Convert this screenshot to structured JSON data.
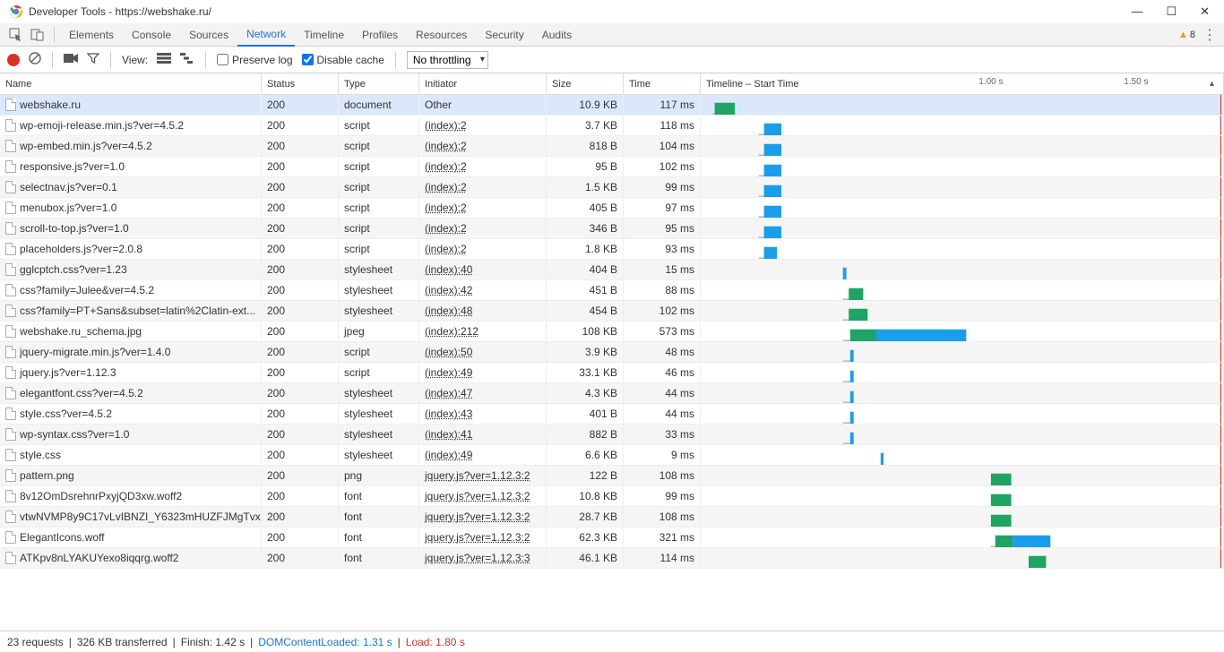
{
  "window": {
    "title": "Developer Tools - https://webshake.ru/"
  },
  "tabs": [
    "Elements",
    "Console",
    "Sources",
    "Network",
    "Timeline",
    "Profiles",
    "Resources",
    "Security",
    "Audits"
  ],
  "active_tab": "Network",
  "warnings_count": "8",
  "toolbar": {
    "view_label": "View:",
    "preserve_log": "Preserve log",
    "preserve_log_checked": false,
    "disable_cache": "Disable cache",
    "disable_cache_checked": true,
    "throttling": "No throttling"
  },
  "columns": {
    "name": "Name",
    "status": "Status",
    "type": "Type",
    "initiator": "Initiator",
    "size": "Size",
    "time": "Time",
    "timeline": "Timeline – Start Time"
  },
  "timeline": {
    "total_ms": 1800,
    "ticks": [
      {
        "ms": 1000,
        "label": "1.00 s"
      },
      {
        "ms": 1500,
        "label": "1.50 s"
      }
    ],
    "red_line_ms": 1790
  },
  "requests": [
    {
      "name": "webshake.ru",
      "status": "200",
      "type": "document",
      "initiator": "Other",
      "initiator_link": false,
      "size": "10.9 KB",
      "time": "117 ms",
      "selected": true,
      "bar": {
        "start": 40,
        "wait": 8,
        "ttfb": 70,
        "content": 0
      }
    },
    {
      "name": "wp-emoji-release.min.js?ver=4.5.2",
      "status": "200",
      "type": "script",
      "initiator": "(index):2",
      "initiator_link": true,
      "size": "3.7 KB",
      "time": "118 ms",
      "bar": {
        "start": 200,
        "wait": 18,
        "ttfb": 0,
        "content": 60
      }
    },
    {
      "name": "wp-embed.min.js?ver=4.5.2",
      "status": "200",
      "type": "script",
      "initiator": "(index):2",
      "initiator_link": true,
      "size": "818 B",
      "time": "104 ms",
      "bar": {
        "start": 200,
        "wait": 18,
        "ttfb": 0,
        "content": 60
      }
    },
    {
      "name": "responsive.js?ver=1.0",
      "status": "200",
      "type": "script",
      "initiator": "(index):2",
      "initiator_link": true,
      "size": "95 B",
      "time": "102 ms",
      "bar": {
        "start": 200,
        "wait": 18,
        "ttfb": 0,
        "content": 60
      }
    },
    {
      "name": "selectnav.js?ver=0.1",
      "status": "200",
      "type": "script",
      "initiator": "(index):2",
      "initiator_link": true,
      "size": "1.5 KB",
      "time": "99 ms",
      "bar": {
        "start": 200,
        "wait": 18,
        "ttfb": 0,
        "content": 60
      }
    },
    {
      "name": "menubox.js?ver=1.0",
      "status": "200",
      "type": "script",
      "initiator": "(index):2",
      "initiator_link": true,
      "size": "405 B",
      "time": "97 ms",
      "bar": {
        "start": 200,
        "wait": 18,
        "ttfb": 0,
        "content": 60
      }
    },
    {
      "name": "scroll-to-top.js?ver=1.0",
      "status": "200",
      "type": "script",
      "initiator": "(index):2",
      "initiator_link": true,
      "size": "346 B",
      "time": "95 ms",
      "bar": {
        "start": 200,
        "wait": 18,
        "ttfb": 0,
        "content": 60
      }
    },
    {
      "name": "placeholders.js?ver=2.0.8",
      "status": "200",
      "type": "script",
      "initiator": "(index):2",
      "initiator_link": true,
      "size": "1.8 KB",
      "time": "93 ms",
      "bar": {
        "start": 200,
        "wait": 18,
        "ttfb": 0,
        "content": 45
      }
    },
    {
      "name": "gglcptch.css?ver=1.23",
      "status": "200",
      "type": "stylesheet",
      "initiator": "(index):40",
      "initiator_link": true,
      "size": "404 B",
      "time": "15 ms",
      "bar": {
        "start": 490,
        "wait": 0,
        "ttfb": 0,
        "content": 12
      }
    },
    {
      "name": "css?family=Julee&ver=4.5.2",
      "status": "200",
      "type": "stylesheet",
      "initiator": "(index):42",
      "initiator_link": true,
      "size": "451 B",
      "time": "88 ms",
      "bar": {
        "start": 490,
        "wait": 20,
        "ttfb": 50,
        "content": 0
      }
    },
    {
      "name": "css?family=PT+Sans&subset=latin%2Clatin-ext...",
      "status": "200",
      "type": "stylesheet",
      "initiator": "(index):48",
      "initiator_link": true,
      "size": "454 B",
      "time": "102 ms",
      "bar": {
        "start": 490,
        "wait": 20,
        "ttfb": 65,
        "content": 0
      }
    },
    {
      "name": "webshake.ru_schema.jpg",
      "status": "200",
      "type": "jpeg",
      "initiator": "(index):212",
      "initiator_link": true,
      "size": "108 KB",
      "time": "573 ms",
      "bar": {
        "start": 490,
        "wait": 25,
        "ttfb": 90,
        "content": 310
      }
    },
    {
      "name": "jquery-migrate.min.js?ver=1.4.0",
      "status": "200",
      "type": "script",
      "initiator": "(index):50",
      "initiator_link": true,
      "size": "3.9 KB",
      "time": "48 ms",
      "bar": {
        "start": 490,
        "wait": 25,
        "ttfb": 0,
        "content": 12
      }
    },
    {
      "name": "jquery.js?ver=1.12.3",
      "status": "200",
      "type": "script",
      "initiator": "(index):49",
      "initiator_link": true,
      "size": "33.1 KB",
      "time": "46 ms",
      "bar": {
        "start": 490,
        "wait": 25,
        "ttfb": 0,
        "content": 12
      }
    },
    {
      "name": "elegantfont.css?ver=4.5.2",
      "status": "200",
      "type": "stylesheet",
      "initiator": "(index):47",
      "initiator_link": true,
      "size": "4.3 KB",
      "time": "44 ms",
      "bar": {
        "start": 490,
        "wait": 25,
        "ttfb": 0,
        "content": 12
      }
    },
    {
      "name": "style.css?ver=4.5.2",
      "status": "200",
      "type": "stylesheet",
      "initiator": "(index):43",
      "initiator_link": true,
      "size": "401 B",
      "time": "44 ms",
      "bar": {
        "start": 490,
        "wait": 25,
        "ttfb": 0,
        "content": 12
      }
    },
    {
      "name": "wp-syntax.css?ver=1.0",
      "status": "200",
      "type": "stylesheet",
      "initiator": "(index):41",
      "initiator_link": true,
      "size": "882 B",
      "time": "33 ms",
      "bar": {
        "start": 490,
        "wait": 25,
        "ttfb": 0,
        "content": 12
      }
    },
    {
      "name": "style.css",
      "status": "200",
      "type": "stylesheet",
      "initiator": "(index):49",
      "initiator_link": true,
      "size": "6.6 KB",
      "time": "9 ms",
      "bar": {
        "start": 620,
        "wait": 0,
        "ttfb": 0,
        "content": 10
      }
    },
    {
      "name": "pattern.png",
      "status": "200",
      "type": "png",
      "initiator": "jquery.js?ver=1.12.3:2",
      "initiator_link": true,
      "size": "122 B",
      "time": "108 ms",
      "bar": {
        "start": 1000,
        "wait": 0,
        "ttfb": 70,
        "content": 0
      }
    },
    {
      "name": "8v12OmDsrehnrPxyjQD3xw.woff2",
      "status": "200",
      "type": "font",
      "initiator": "jquery.js?ver=1.12.3:2",
      "initiator_link": true,
      "size": "10.8 KB",
      "time": "99 ms",
      "bar": {
        "start": 1000,
        "wait": 0,
        "ttfb": 70,
        "content": 0
      }
    },
    {
      "name": "vtwNVMP8y9C17vLvIBNZI_Y6323mHUZFJMgTvx...",
      "status": "200",
      "type": "font",
      "initiator": "jquery.js?ver=1.12.3:2",
      "initiator_link": true,
      "size": "28.7 KB",
      "time": "108 ms",
      "bar": {
        "start": 1000,
        "wait": 0,
        "ttfb": 70,
        "content": 0
      }
    },
    {
      "name": "ElegantIcons.woff",
      "status": "200",
      "type": "font",
      "initiator": "jquery.js?ver=1.12.3:2",
      "initiator_link": true,
      "size": "62.3 KB",
      "time": "321 ms",
      "bar": {
        "start": 1000,
        "wait": 15,
        "ttfb": 60,
        "content": 130
      }
    },
    {
      "name": "ATKpv8nLYAKUYexo8iqqrg.woff2",
      "status": "200",
      "type": "font",
      "initiator": "jquery.js?ver=1.12.3:3",
      "initiator_link": true,
      "size": "46.1 KB",
      "time": "114 ms",
      "bar": {
        "start": 1130,
        "wait": 0,
        "ttfb": 60,
        "content": 0
      }
    }
  ],
  "statusbar": {
    "requests": "23 requests",
    "transferred": "326 KB transferred",
    "finish": "Finish: 1.42 s",
    "dcl": "DOMContentLoaded: 1.31 s",
    "load": "Load: 1.80 s"
  }
}
